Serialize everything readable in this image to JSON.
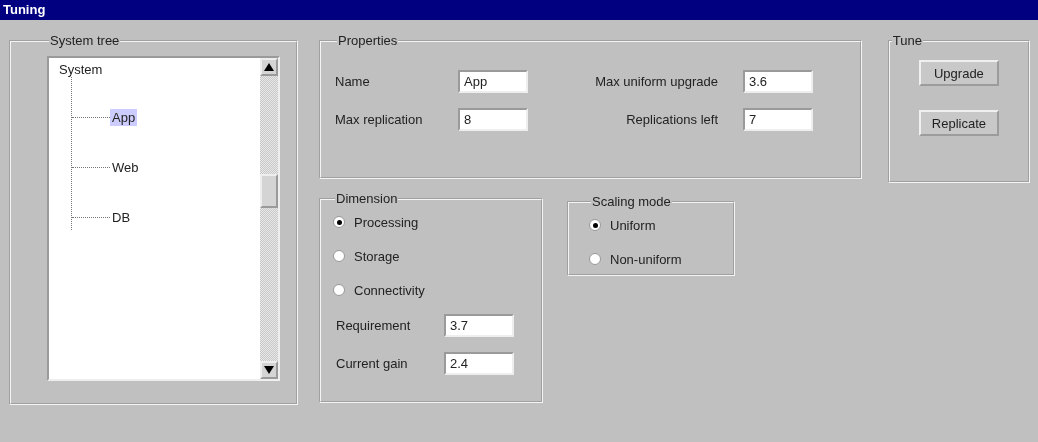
{
  "window": {
    "title": "Tuning"
  },
  "system_tree": {
    "title": "System tree",
    "root": {
      "label": "System",
      "selected": false,
      "children": [
        {
          "label": "App",
          "selected": true
        },
        {
          "label": "Web",
          "selected": false
        },
        {
          "label": "DB",
          "selected": false
        }
      ]
    }
  },
  "properties": {
    "title": "Properties",
    "fields": [
      {
        "label": "Name",
        "value": "App"
      },
      {
        "label": "Max uniform upgrade",
        "value": "3.6"
      },
      {
        "label": "Max replication",
        "value": "8"
      },
      {
        "label": "Replications left",
        "value": "7"
      }
    ]
  },
  "dimension": {
    "title": "Dimension",
    "options": [
      {
        "label": "Processing",
        "selected": true
      },
      {
        "label": "Storage",
        "selected": false
      },
      {
        "label": "Connectivity",
        "selected": false
      }
    ],
    "fields": [
      {
        "label": "Requirement",
        "value": "3.7"
      },
      {
        "label": "Current gain",
        "value": "2.4"
      }
    ]
  },
  "scaling_mode": {
    "title": "Scaling mode",
    "options": [
      {
        "label": "Uniform",
        "selected": true
      },
      {
        "label": "Non-uniform",
        "selected": false
      }
    ]
  },
  "tune": {
    "title": "Tune",
    "buttons": [
      "Upgrade",
      "Replicate"
    ]
  }
}
